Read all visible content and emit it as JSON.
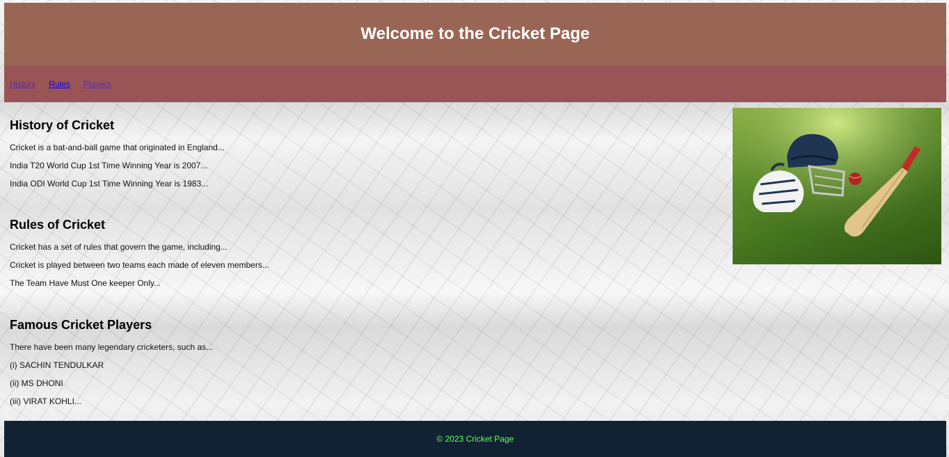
{
  "header": {
    "title": "Welcome to the Cricket Page"
  },
  "nav": {
    "items": [
      {
        "label": "History",
        "state": "visited"
      },
      {
        "label": "Rules",
        "state": "active"
      },
      {
        "label": "Players",
        "state": "visited"
      }
    ]
  },
  "sections": {
    "history": {
      "heading": "History of Cricket",
      "lines": [
        "Cricket is a bat-and-ball game that originated in England...",
        "India T20 World Cup 1st Time Winning Year is 2007...",
        "India ODI World Cup 1st Time Winning Year is 1983..."
      ]
    },
    "rules": {
      "heading": "Rules of Cricket",
      "lines": [
        "Cricket has a set of rules that govern the game, including...",
        "Cricket is played between two teams each made of eleven members...",
        "The Team Have Must One keeper Only..."
      ]
    },
    "players": {
      "heading": "Famous Cricket Players",
      "lines": [
        "There have been many legendary cricketers, such as...",
        "(i) SACHIN TENDULKAR",
        "(ii) MS DHONI",
        "(iii) VIRAT KOHLI..."
      ]
    }
  },
  "footer": {
    "text": "© 2023 Cricket Page"
  },
  "colors": {
    "header_bg": "#996655",
    "nav_bg": "#995555",
    "footer_bg": "#112233",
    "footer_text": "#66ff66",
    "link_visited": "#5b2a9a",
    "link_active": "#0000ee"
  }
}
